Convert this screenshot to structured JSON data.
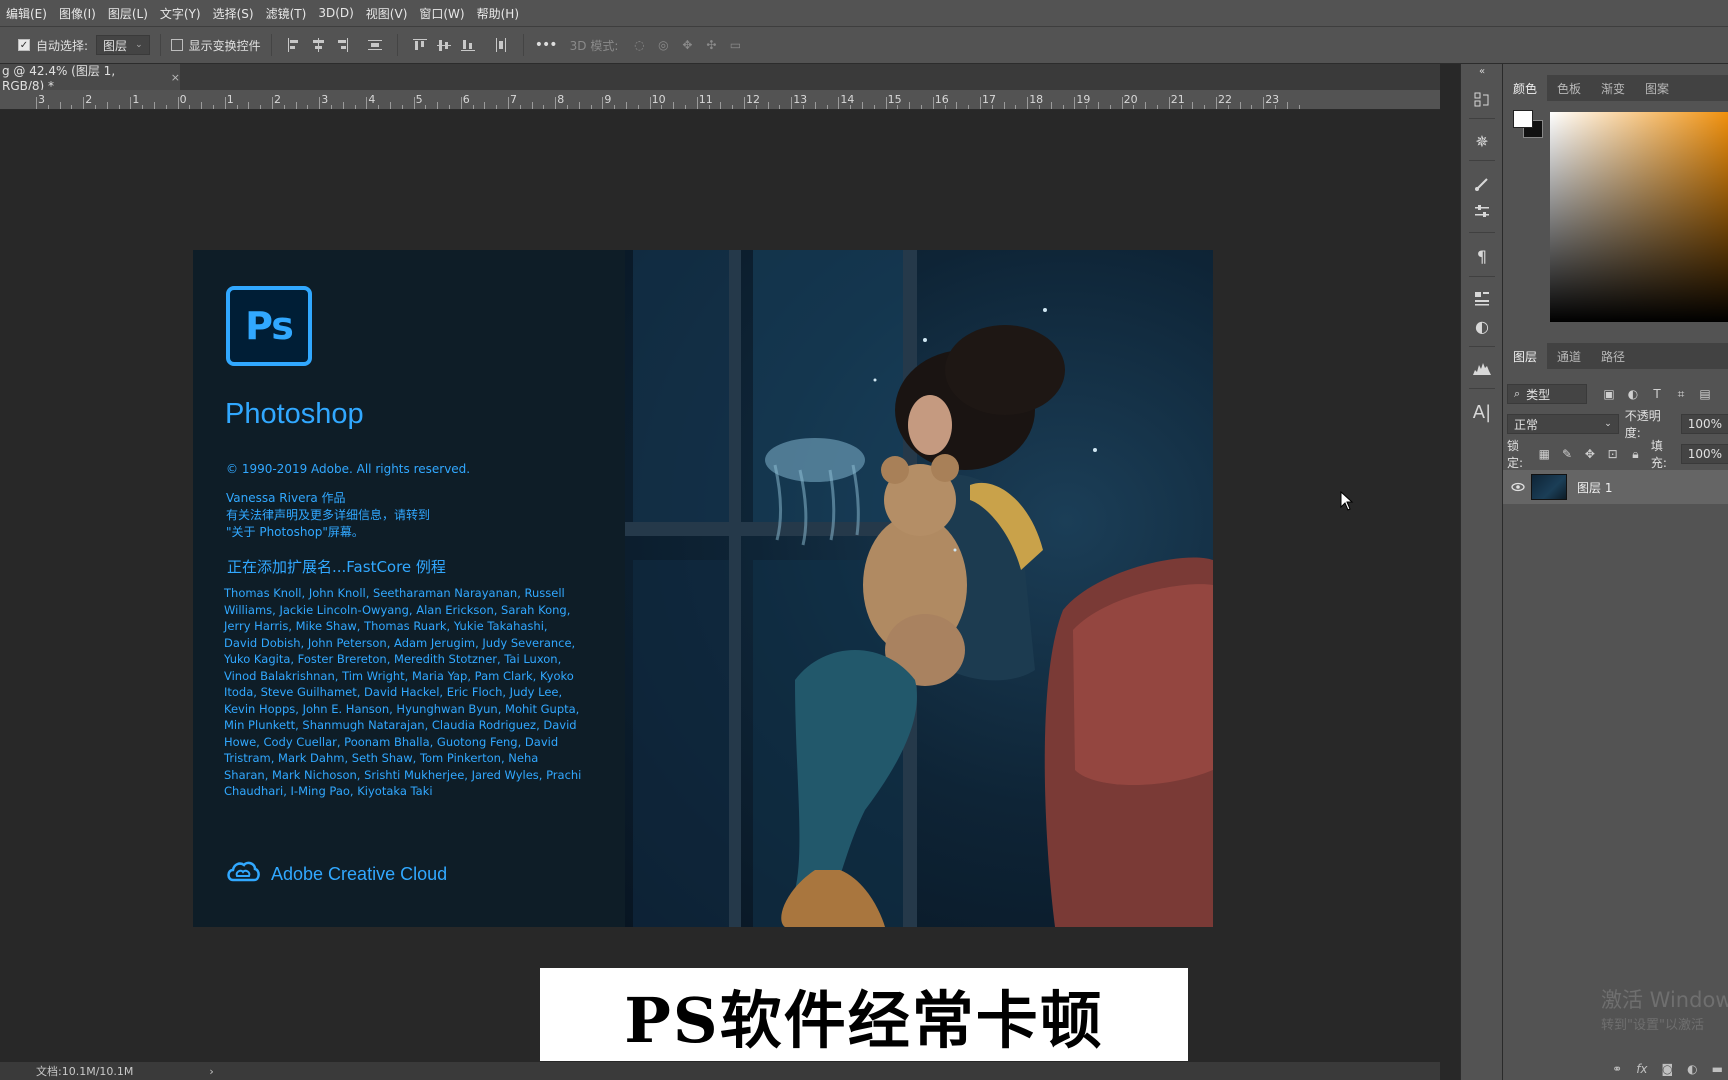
{
  "menu": [
    "编辑(E)",
    "图像(I)",
    "图层(L)",
    "文字(Y)",
    "选择(S)",
    "滤镜(T)",
    "3D(D)",
    "视图(V)",
    "窗口(W)",
    "帮助(H)"
  ],
  "options": {
    "auto_select_label": "自动选择:",
    "auto_select_value": "图层",
    "show_transform_label": "显示变换控件",
    "mode_3d_label": "3D 模式:"
  },
  "document": {
    "tab_title": "g @ 42.4% (图层 1, RGB/8) *",
    "ruler_ticks": [
      "3",
      "2",
      "1",
      "0",
      "1",
      "2",
      "3",
      "4",
      "5",
      "6",
      "7",
      "8",
      "9",
      "10",
      "11",
      "12",
      "13",
      "14",
      "15",
      "16",
      "17",
      "18",
      "19",
      "20",
      "21",
      "22",
      "23"
    ]
  },
  "splash": {
    "logo_text": "Ps",
    "product": "Photoshop",
    "copyright": "© 1990-2019 Adobe. All rights reserved.",
    "author_line1": "Vanessa Rivera 作品",
    "author_line2": "有关法律声明及更多详细信息，请转到",
    "author_line3": "\"关于 Photoshop\"屏幕。",
    "loading": "正在添加扩展名...FastCore 例程",
    "credits": "Thomas Knoll, John Knoll, Seetharaman Narayanan, Russell Williams, Jackie Lincoln-Owyang, Alan Erickson, Sarah Kong, Jerry Harris, Mike Shaw, Thomas Ruark, Yukie Takahashi, David Dobish, John Peterson, Adam Jerugim, Judy Severance, Yuko Kagita, Foster Brereton, Meredith Stotzner, Tai Luxon, Vinod Balakrishnan, Tim Wright, Maria Yap, Pam Clark, Kyoko Itoda, Steve Guilhamet, David Hackel, Eric Floch, Judy Lee, Kevin Hopps, John E. Hanson, Hyunghwan Byun, Mohit Gupta, Min Plunkett, Shanmugh Natarajan, Claudia Rodriguez, David Howe, Cody Cuellar, Poonam Bhalla, Guotong Feng, David Tristram, Mark Dahm, Seth Shaw, Tom Pinkerton, Neha Sharan, Mark Nichoson, Srishti Mukherjee, Jared Wyles, Prachi Chaudhari, I-Ming Pao, Kiyotaka Taki",
    "cloud_label": "Adobe Creative Cloud"
  },
  "caption": "PS软件经常卡顿",
  "status": {
    "doc_info": "文档:10.1M/10.1M",
    "arrow": "›"
  },
  "color_panel": {
    "tabs": [
      "颜色",
      "色板",
      "渐变",
      "图案"
    ],
    "active_tab": "颜色"
  },
  "layers_panel": {
    "tabs": [
      "图层",
      "通道",
      "路径"
    ],
    "active_tab": "图层",
    "filter_kind": "类型",
    "blend_mode": "正常",
    "opacity_label": "不透明度:",
    "opacity_value": "100%",
    "lock_label": "锁定:",
    "fill_label": "填充:",
    "fill_value": "100%",
    "layer_name": "图层 1"
  },
  "watermark": {
    "line1": "激活 Window",
    "line2": "转到\"设置\"以激活"
  },
  "colors": {
    "ps_blue": "#31a8ff",
    "ui_panel": "#535353",
    "canvas_bg": "#282828"
  },
  "icons": {
    "eye": "eye-icon",
    "close": "close-icon",
    "cursor": "arrow-cursor-icon"
  }
}
